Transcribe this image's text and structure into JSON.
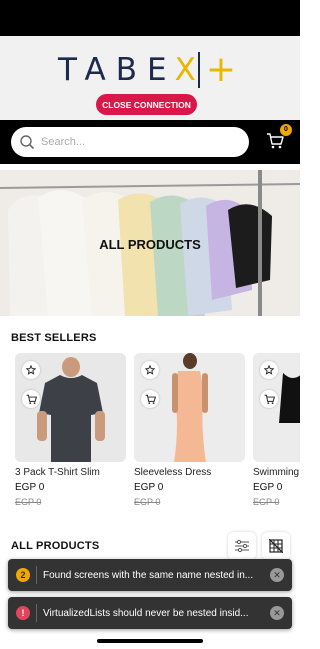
{
  "header": {
    "logo_text": "TABE",
    "logo_x": "X",
    "logo_plus": "+",
    "close_connection_label": "CLOSE CONNECTION"
  },
  "search": {
    "placeholder": "Search..."
  },
  "cart": {
    "badge_count": "0"
  },
  "hero": {
    "title": "ALL PRODUCTS"
  },
  "best_sellers": {
    "title": "BEST SELLERS",
    "products": [
      {
        "name": "3 Pack T-Shirt Slim",
        "price": "EGP 0",
        "old_price": "EGP 0"
      },
      {
        "name": "Sleeveless Dress",
        "price": "EGP 0",
        "old_price": "EGP 0"
      },
      {
        "name": "Swimming",
        "price": "EGP 0",
        "old_price": "EGP 0"
      }
    ]
  },
  "all_products": {
    "title": "ALL PRODUCTS"
  },
  "toasts": [
    {
      "count": "2",
      "text": "Found screens with the same name nested in...",
      "color": "#f0a800"
    },
    {
      "count": "!",
      "text": "VirtualizedLists should never be nested insid...",
      "color": "#e0455a"
    }
  ],
  "colors": {
    "brand_navy": "#1c2a4c",
    "brand_gold": "#e6b800",
    "close_button": "#d9184a"
  }
}
